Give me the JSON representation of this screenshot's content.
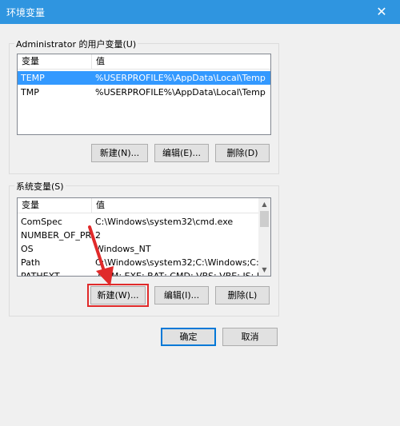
{
  "window": {
    "title": "环境变量",
    "close_glyph": "✕"
  },
  "user_vars": {
    "group_label": "Administrator 的用户变量(U)",
    "headers": [
      "变量",
      "值"
    ],
    "rows": [
      {
        "name": "TEMP",
        "value": "%USERPROFILE%\\AppData\\Local\\Temp",
        "selected": true
      },
      {
        "name": "TMP",
        "value": "%USERPROFILE%\\AppData\\Local\\Temp",
        "selected": false
      }
    ],
    "buttons": {
      "new": "新建(N)...",
      "edit": "编辑(E)...",
      "delete": "删除(D)"
    }
  },
  "system_vars": {
    "group_label": "系统变量(S)",
    "headers": [
      "变量",
      "值"
    ],
    "rows": [
      {
        "name": "ComSpec",
        "value": "C:\\Windows\\system32\\cmd.exe"
      },
      {
        "name": "NUMBER_OF_PR...",
        "value": "2"
      },
      {
        "name": "OS",
        "value": "Windows_NT"
      },
      {
        "name": "Path",
        "value": "C:\\Windows\\system32;C:\\Windows;C:\\Wi..."
      },
      {
        "name": "PATHEXT",
        "value": ".COM;.EXE;.BAT;.CMD;.VBS;.VBE;.JS;.JSE;..."
      }
    ],
    "buttons": {
      "new": "新建(W)...",
      "edit": "编辑(I)...",
      "delete": "删除(L)"
    }
  },
  "dialog_buttons": {
    "ok": "确定",
    "cancel": "取消"
  },
  "colors": {
    "accent": "#2f95e0",
    "selection": "#3399ff",
    "annotation": "#e02a2a"
  }
}
